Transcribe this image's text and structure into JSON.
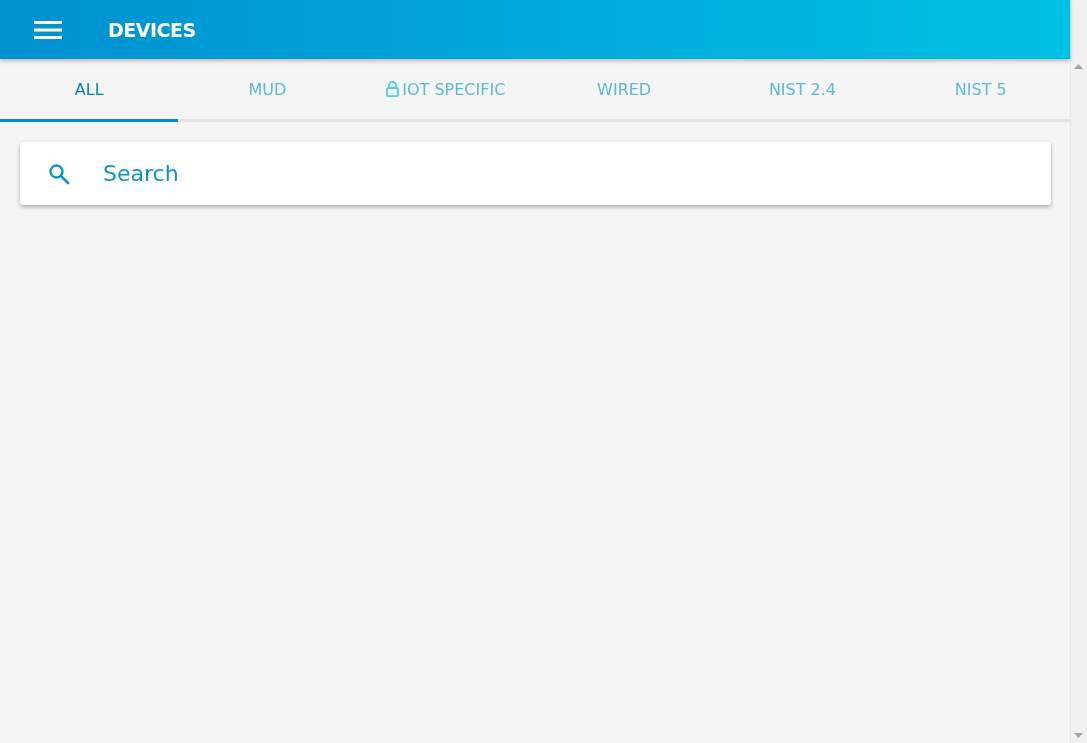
{
  "app_bar": {
    "title": "DEVICES"
  },
  "tabs": [
    {
      "label": "ALL",
      "selected": true,
      "locked": false
    },
    {
      "label": "MUD",
      "selected": false,
      "locked": false
    },
    {
      "label": "IOT SPECIFIC",
      "selected": false,
      "locked": true
    },
    {
      "label": "WIRED",
      "selected": false,
      "locked": false
    },
    {
      "label": "NIST 2.4",
      "selected": false,
      "locked": false
    },
    {
      "label": "NIST 5",
      "selected": false,
      "locked": false
    }
  ],
  "search": {
    "placeholder": "Search"
  }
}
